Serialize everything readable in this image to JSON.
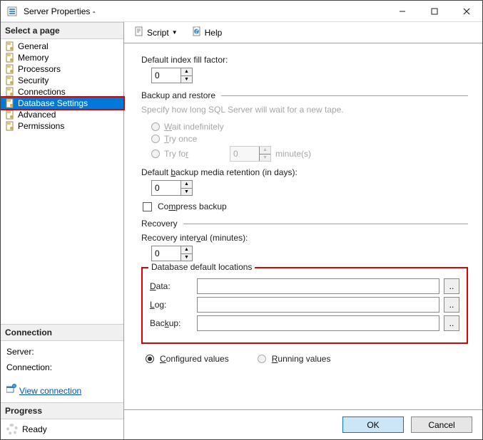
{
  "window": {
    "title": "Server Properties -"
  },
  "titlebtns": {
    "min": "—",
    "max": "☐",
    "close": "✕"
  },
  "left": {
    "select_page": "Select a page",
    "nav": [
      "General",
      "Memory",
      "Processors",
      "Security",
      "Connections",
      "Database Settings",
      "Advanced",
      "Permissions"
    ],
    "selected_index": 5,
    "connection_hdr": "Connection",
    "server_lbl": "Server:",
    "connection_lbl": "Connection:",
    "view_conn": "View connection ",
    "progress_hdr": "Progress",
    "progress_status": "Ready"
  },
  "toolbar": {
    "script": "Script",
    "help": "Help"
  },
  "content": {
    "fill_factor_lbl": "Default index fill factor:",
    "fill_factor_val": "0",
    "backup_restore_hdr": "Backup and restore",
    "specify_note": "Specify how long SQL Server will wait for a new tape.",
    "wait_indef": "Wait indefinitely",
    "try_once": "Try once",
    "try_for": "Try for",
    "try_for_val": "0",
    "minutes": "minute(s)",
    "def_retention_lbl": "Default backup media retention (in days):",
    "def_retention_val": "0",
    "compress_lbl": "Compress backup",
    "recovery_hdr": "Recovery",
    "recov_interval_lbl": "Recovery interval (minutes):",
    "recov_interval_val": "0",
    "locations_hdr": "Database default locations",
    "data_lbl": "Data:",
    "log_lbl": "Log:",
    "backup_lbl": "Backup:",
    "data_val": "",
    "log_val": "",
    "backup_val": "",
    "browse": "..",
    "configured": "Configured values",
    "running": "Running values"
  },
  "footer": {
    "ok": "OK",
    "cancel": "Cancel"
  }
}
